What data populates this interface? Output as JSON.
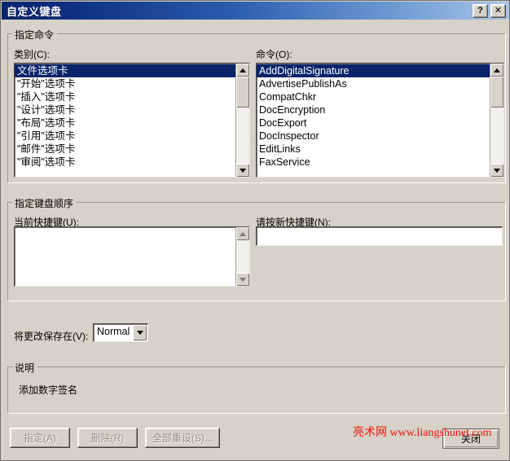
{
  "window": {
    "title": "自定义键盘",
    "help_button": "?",
    "close_button": "✕"
  },
  "groups": {
    "assign_command": "指定命令",
    "keyboard_sequence": "指定键盘顺序",
    "description": "说明"
  },
  "categories": {
    "label": "类别(C):",
    "items": [
      "文件选项卡",
      "\"开始\"选项卡",
      "\"插入\"选项卡",
      "\"设计\"选项卡",
      "\"布局\"选项卡",
      "\"引用\"选项卡",
      "\"邮件\"选项卡",
      "\"审阅\"选项卡"
    ],
    "selected_index": 0
  },
  "commands": {
    "label": "命令(O):",
    "items": [
      "AddDigitalSignature",
      "AdvertisePublishAs",
      "CompatChkr",
      "DocEncryption",
      "DocExport",
      "DocInspector",
      "EditLinks",
      "FaxService"
    ],
    "selected_index": 0
  },
  "current_keys": {
    "label": "当前快捷键(U):",
    "items": []
  },
  "new_key": {
    "label": "请按新快捷键(N):",
    "value": "",
    "placeholder": ""
  },
  "save_in": {
    "label": "将更改保存在(V):",
    "value": "Normal",
    "options": [
      "Normal"
    ]
  },
  "description": {
    "text": "添加数字签名"
  },
  "buttons": {
    "assign": "指定(A)",
    "remove": "删除(R)",
    "reset_all": "全部重设(S)...",
    "close": "关闭"
  },
  "watermark": {
    "text": "亮术网 www.liangshunet.com",
    "color": "#e8140c"
  },
  "colors": {
    "dialog_face": "#d6d2c8",
    "title_gradient_start": "#0a246a",
    "title_gradient_end": "#a9c6e8",
    "selection": "#0a246a",
    "text": "#000000",
    "disabled_text": "#8d8b84"
  }
}
